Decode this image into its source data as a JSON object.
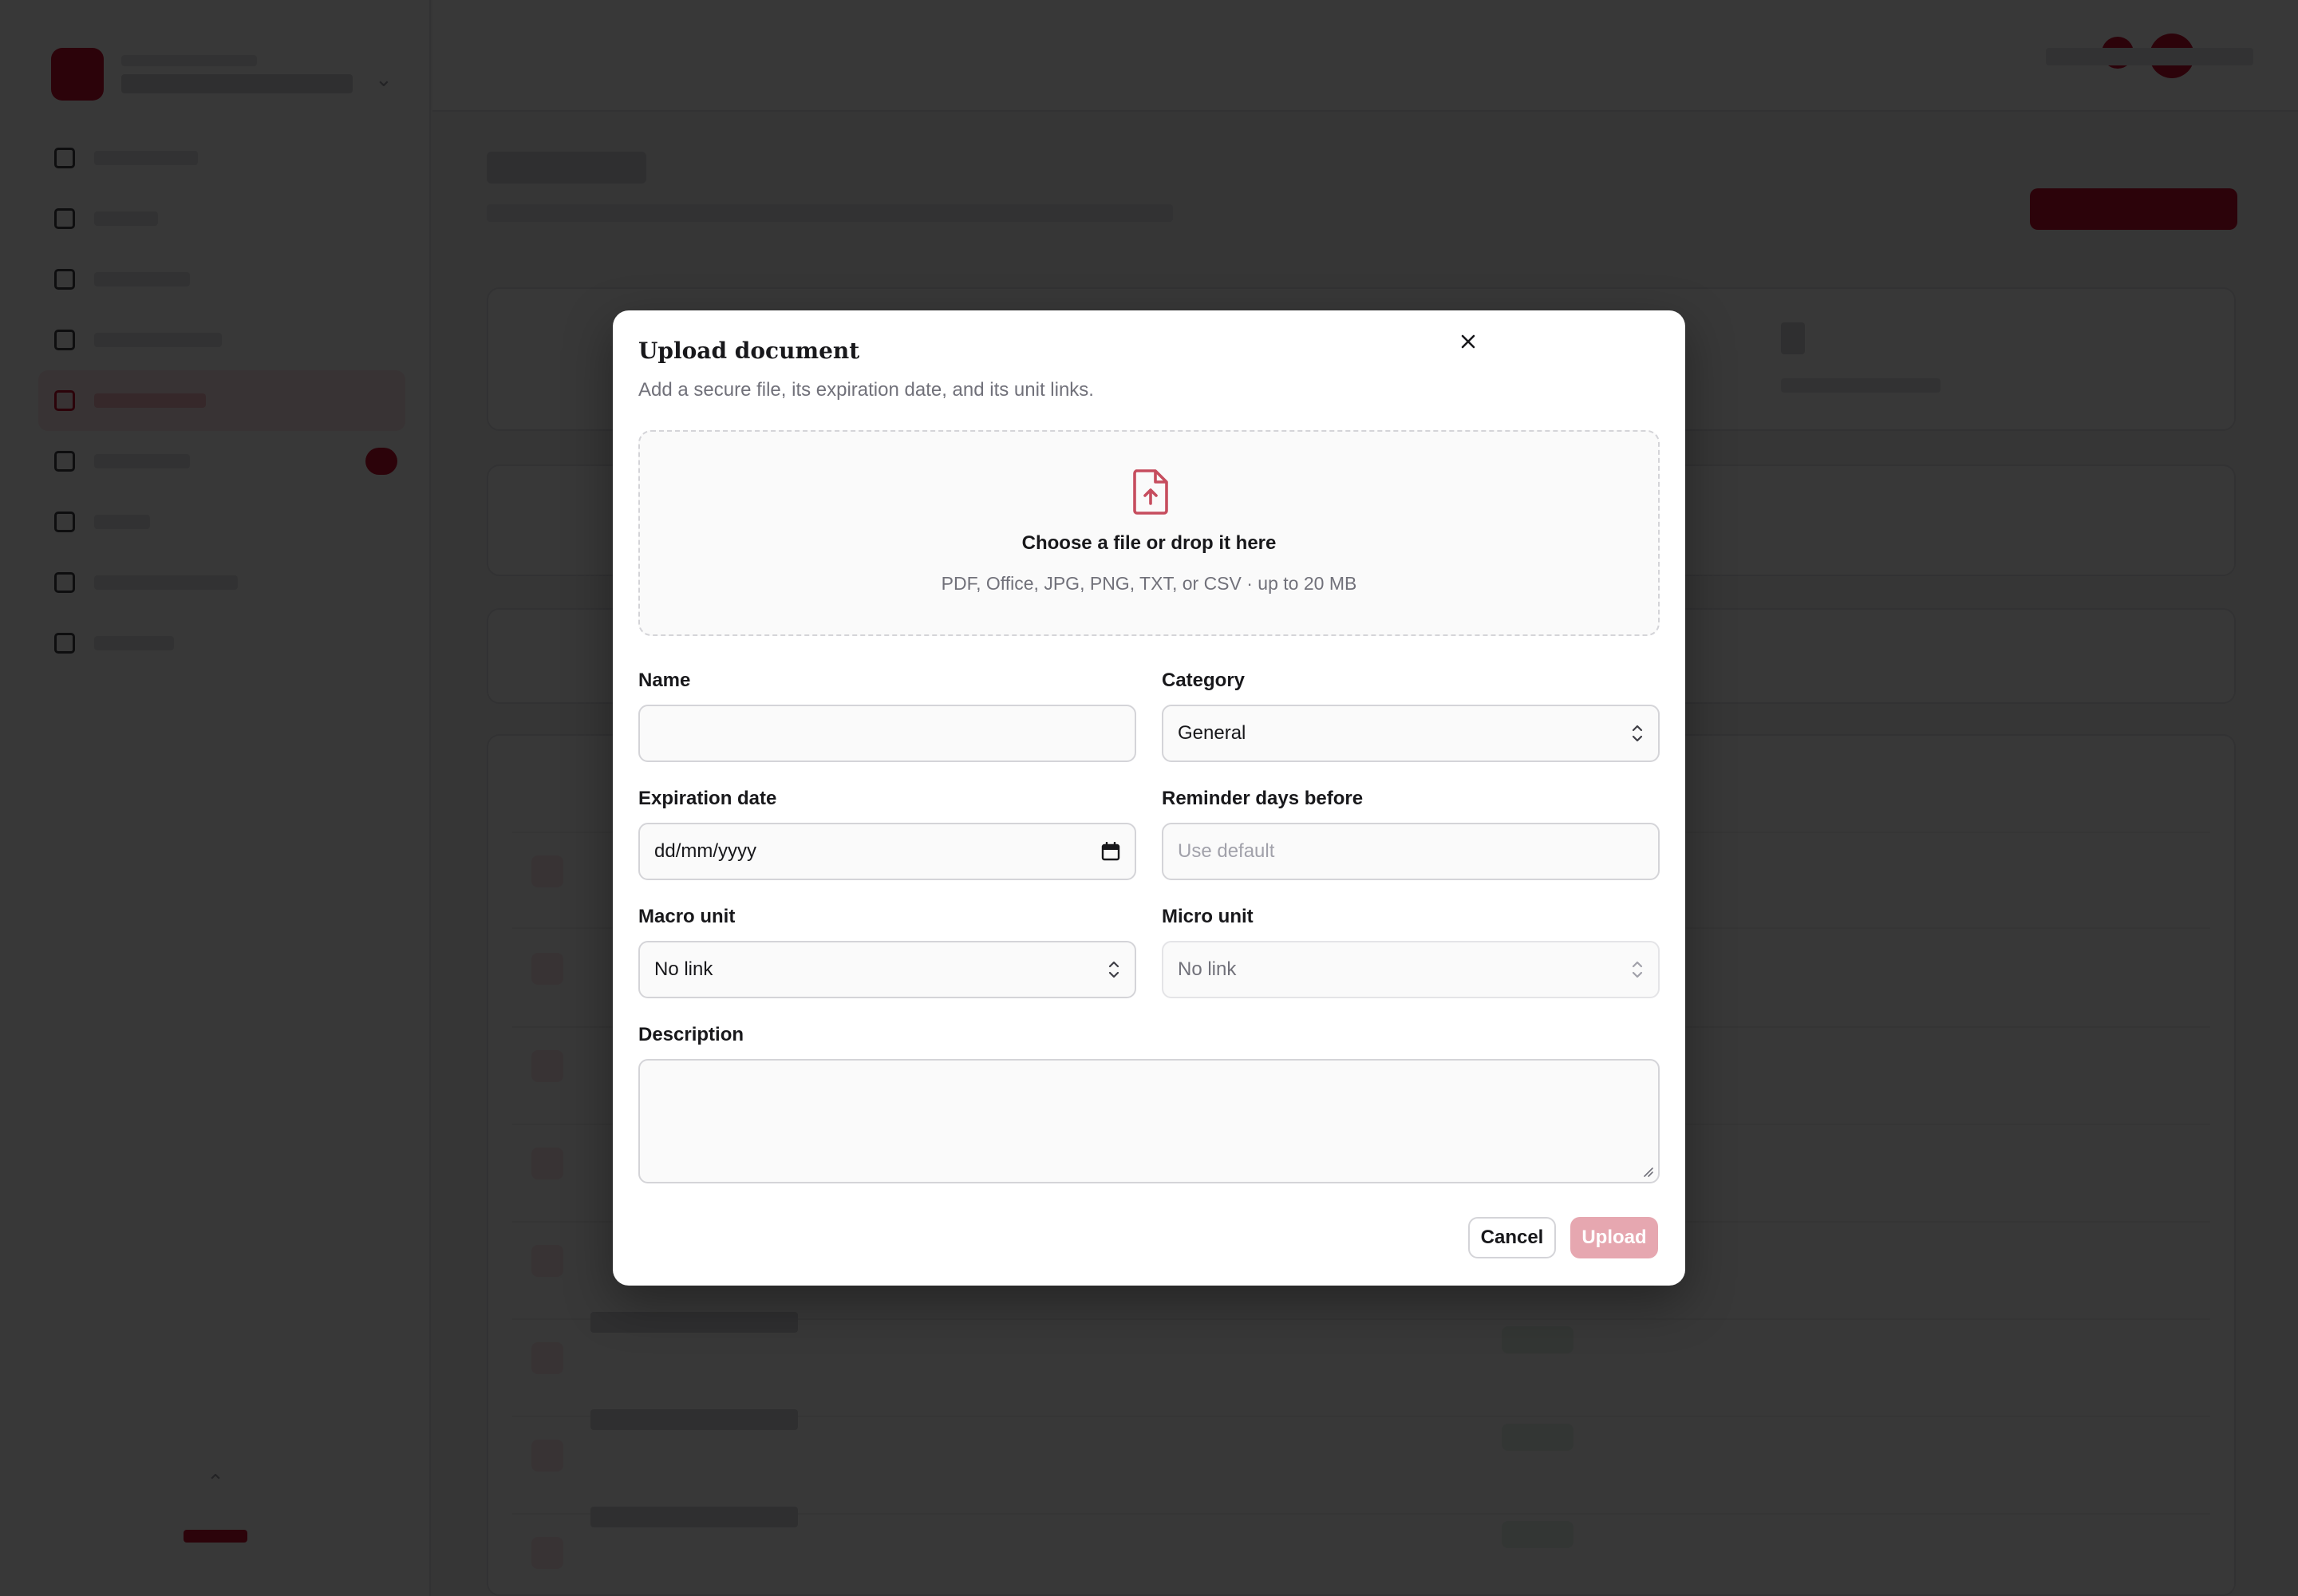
{
  "modal": {
    "title": "Upload document",
    "description": "Add a secure file, its expiration date, and its unit links.",
    "close_icon": "×",
    "dropzone": {
      "icon": "file-upload-icon",
      "title": "Choose a file or drop it here",
      "hint": "PDF, Office, JPG, PNG, TXT, or CSV · up to 20 MB"
    },
    "fields": {
      "name": {
        "label": "Name",
        "value": "",
        "placeholder": ""
      },
      "category": {
        "label": "Category",
        "value": "General"
      },
      "expiration": {
        "label": "Expiration date",
        "value": "dd/mm/yyyy"
      },
      "reminder": {
        "label": "Reminder days before",
        "value": "",
        "placeholder": "Use default"
      },
      "macro_unit": {
        "label": "Macro unit",
        "value": "No link"
      },
      "micro_unit": {
        "label": "Micro unit",
        "value": "No link",
        "disabled": true
      },
      "description": {
        "label": "Description",
        "value": ""
      }
    },
    "buttons": {
      "cancel": "Cancel",
      "upload": "Upload"
    }
  },
  "colors": {
    "accent": "#c8102e",
    "accent_disabled": "#e6a7b0",
    "overlay": "rgba(0,0,0,0.78)"
  }
}
